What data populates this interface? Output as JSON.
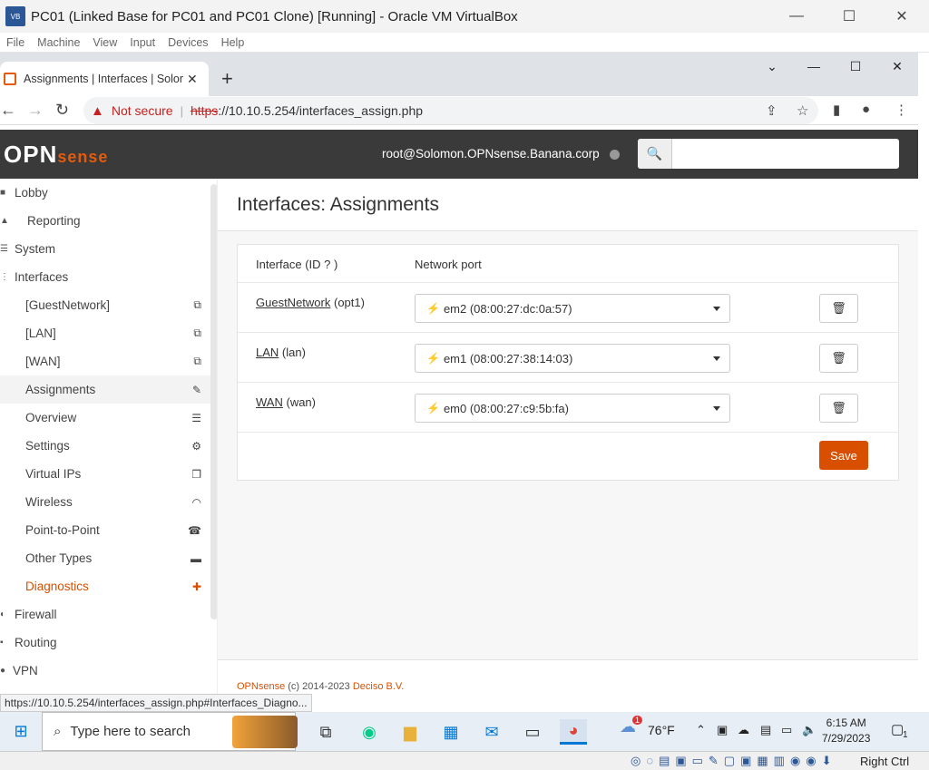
{
  "vbox": {
    "title": "PC01 (Linked Base for PC01 and PC01 Clone) [Running] - Oracle VM VirtualBox",
    "menu": [
      "File",
      "Machine",
      "View",
      "Input",
      "Devices",
      "Help"
    ],
    "right_ctrl": "Right Ctrl"
  },
  "browser": {
    "tab_label": "Assignments | Interfaces | Solomon.OPNsense.Banana.corp",
    "not_secure": "Not secure",
    "url_scheme": "https",
    "url_rest": "://10.10.5.254/interfaces_assign.php",
    "status_url": "https://10.10.5.254/interfaces_assign.php#Interfaces_Diagno..."
  },
  "header": {
    "logo_main": "OPN",
    "logo_sense": "sense",
    "user": "root@Solomon.OPNsense.Banana.corp",
    "search_placeholder": ""
  },
  "sidebar": {
    "items": [
      {
        "label": "Lobby"
      },
      {
        "label": "Reporting"
      },
      {
        "label": "System"
      },
      {
        "label": "Interfaces"
      },
      {
        "label": "[GuestNetwork]"
      },
      {
        "label": "[LAN]"
      },
      {
        "label": "[WAN]"
      },
      {
        "label": "Assignments"
      },
      {
        "label": "Overview"
      },
      {
        "label": "Settings"
      },
      {
        "label": "Virtual IPs"
      },
      {
        "label": "Wireless"
      },
      {
        "label": "Point-to-Point"
      },
      {
        "label": "Other Types"
      },
      {
        "label": "Diagnostics"
      },
      {
        "label": "Firewall"
      },
      {
        "label": "Routing"
      },
      {
        "label": "VPN"
      }
    ]
  },
  "page": {
    "title": "Interfaces: Assignments",
    "col_interface": "Interface (ID",
    "col_interface_end": ")",
    "col_port": "Network port",
    "rows": [
      {
        "name": "GuestNetwork",
        "id": "(opt1)",
        "port": "em2 (08:00:27:dc:0a:57)"
      },
      {
        "name": "LAN",
        "id": "(lan)",
        "port": "em1 (08:00:27:38:14:03)"
      },
      {
        "name": "WAN",
        "id": "(wan)",
        "port": "em0 (08:00:27:c9:5b:fa)"
      }
    ],
    "save_label": "Save",
    "footer_brand": "OPNsense",
    "footer_copy": "(c) 2014-2023",
    "footer_company": "Deciso B.V."
  },
  "taskbar": {
    "search_placeholder": "Type here to search",
    "weather": "76°F",
    "weather_badge": "1",
    "time": "6:15 AM",
    "date": "7/29/2023",
    "notif_count": "1"
  }
}
